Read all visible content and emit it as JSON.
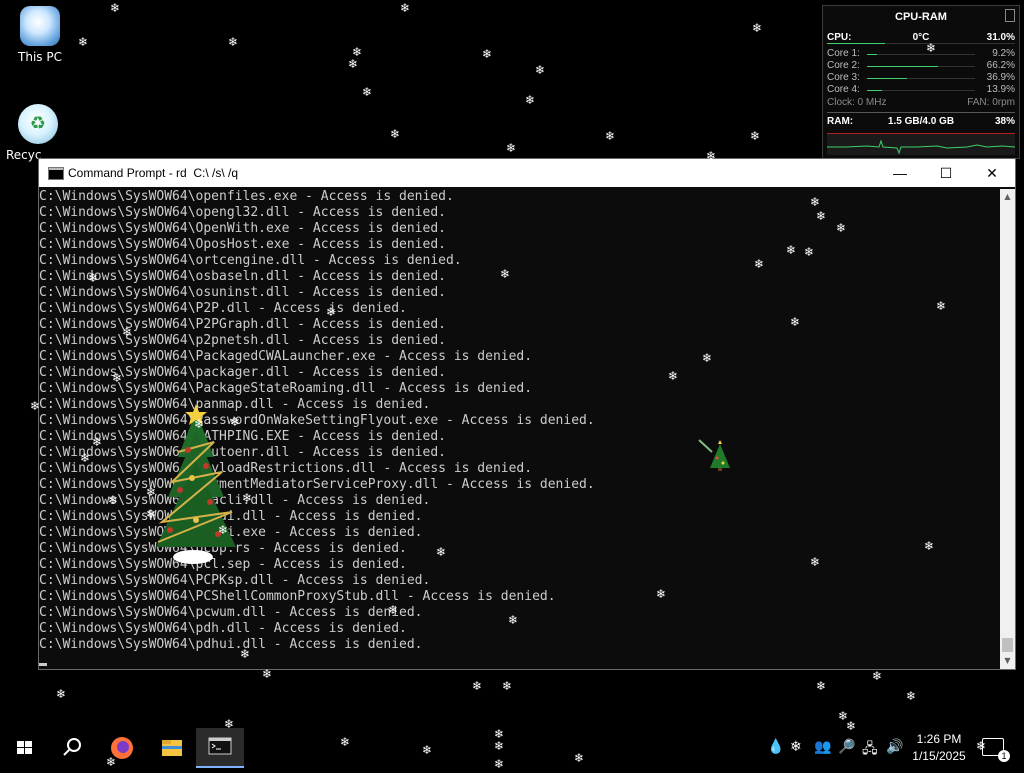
{
  "desktop": {
    "icons": [
      {
        "label": "This PC"
      },
      {
        "label": "Recyc"
      }
    ]
  },
  "gadget": {
    "title": "CPU-RAM",
    "cpu_label": "CPU:",
    "cpu_temp": "0°C",
    "cpu_percent": "31.0%",
    "cpu_fraction": 0.31,
    "cores": [
      {
        "label": "Core 1:",
        "value": "9.2%",
        "fraction": 0.092
      },
      {
        "label": "Core 2:",
        "value": "66.2%",
        "fraction": 0.662
      },
      {
        "label": "Core 3:",
        "value": "36.9%",
        "fraction": 0.369
      },
      {
        "label": "Core 4:",
        "value": "13.9%",
        "fraction": 0.139
      }
    ],
    "clock_label": "Clock: 0 MHz",
    "fan_label": "FAN: 0rpm",
    "ram_label": "RAM:",
    "ram_usage": "1.5 GB/4.0 GB",
    "ram_percent": "38%",
    "accent_color": "#3fd26a"
  },
  "window": {
    "title": "Command Prompt - rd  C:\\ /s\\ /q",
    "controls": {
      "minimize": "—",
      "maximize": "☐",
      "close": "✕"
    }
  },
  "console": {
    "lines": [
      "C:\\Windows\\SysWOW64\\openfiles.exe - Access is denied.",
      "C:\\Windows\\SysWOW64\\opengl32.dll - Access is denied.",
      "C:\\Windows\\SysWOW64\\OpenWith.exe - Access is denied.",
      "C:\\Windows\\SysWOW64\\OposHost.exe - Access is denied.",
      "C:\\Windows\\SysWOW64\\ortcengine.dll - Access is denied.",
      "C:\\Windows\\SysWOW64\\osbaseln.dll - Access is denied.",
      "C:\\Windows\\SysWOW64\\osuninst.dll - Access is denied.",
      "C:\\Windows\\SysWOW64\\P2P.dll - Access is denied.",
      "C:\\Windows\\SysWOW64\\P2PGraph.dll - Access is denied.",
      "C:\\Windows\\SysWOW64\\p2pnetsh.dll - Access is denied.",
      "C:\\Windows\\SysWOW64\\PackagedCWALauncher.exe - Access is denied.",
      "C:\\Windows\\SysWOW64\\packager.dll - Access is denied.",
      "C:\\Windows\\SysWOW64\\PackageStateRoaming.dll - Access is denied.",
      "C:\\Windows\\SysWOW64\\panmap.dll - Access is denied.",
      "C:\\Windows\\SysWOW64\\PasswordOnWakeSettingFlyout.exe - Access is denied.",
      "C:\\Windows\\SysWOW64\\PATHPING.EXE - Access is denied.",
      "C:\\Windows\\SysWOW64\\pautoenr.dll - Access is denied.",
      "C:\\Windows\\SysWOW64\\PayloadRestrictions.dll - Access is denied.",
      "C:\\Windows\\SysWOW64\\PaymentMediatorServiceProxy.dll - Access is denied.",
      "C:\\Windows\\SysWOW64\\pcacli.dll - Access is denied.",
      "C:\\Windows\\SysWOW64\\pcaui.dll - Access is denied.",
      "C:\\Windows\\SysWOW64\\pcaui.exe - Access is denied.",
      "C:\\Windows\\SysWOW64\\pcbp.rs - Access is denied.",
      "C:\\Windows\\SysWOW64\\pcl.sep - Access is denied.",
      "C:\\Windows\\SysWOW64\\PCPKsp.dll - Access is denied.",
      "C:\\Windows\\SysWOW64\\PCShellCommonProxyStub.dll - Access is denied.",
      "C:\\Windows\\SysWOW64\\pcwum.dll - Access is denied.",
      "C:\\Windows\\SysWOW64\\pdh.dll - Access is denied.",
      "C:\\Windows\\SysWOW64\\pdhui.dll - Access is denied."
    ]
  },
  "taskbar": {
    "time": "1:26 PM",
    "date": "1/15/2025",
    "notification_count": "1",
    "tray_icons": [
      "droplet-icon",
      "snowflake-icon",
      "network-people-icon",
      "magnifier-icon",
      "network-icon",
      "volume-icon"
    ]
  }
}
